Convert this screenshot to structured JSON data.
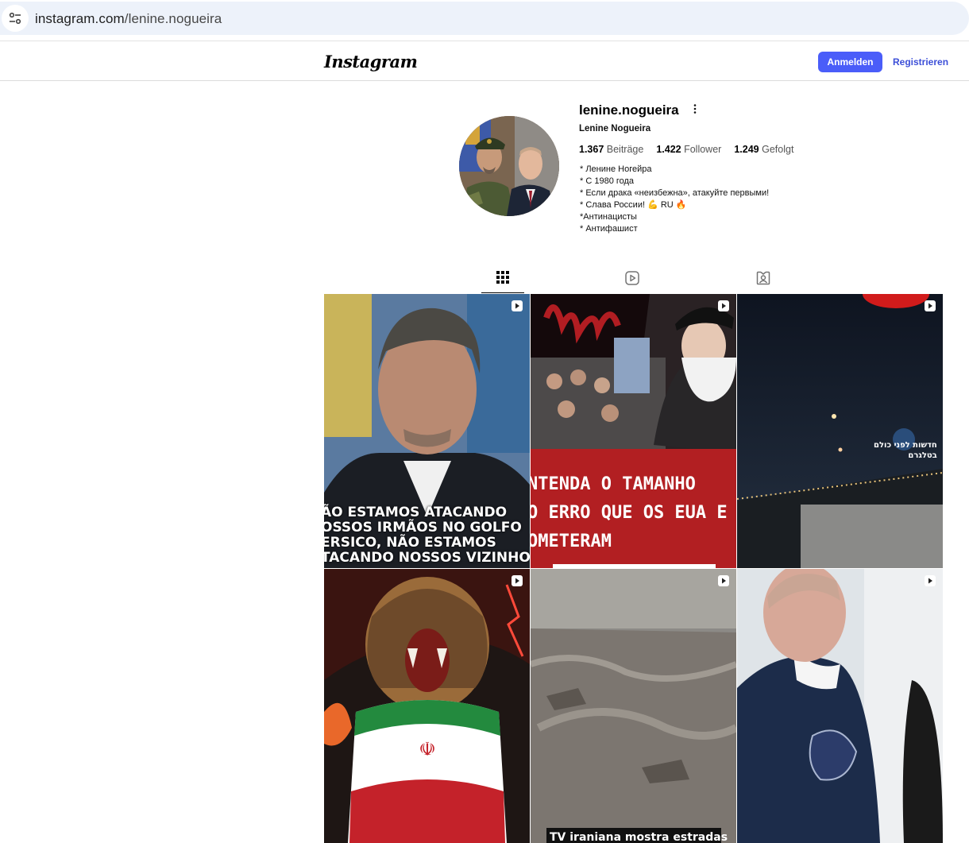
{
  "browser": {
    "url_domain": "instagram.com",
    "url_path": "/lenine.nogueira"
  },
  "header": {
    "logo": "Instagram",
    "login_label": "Anmelden",
    "register_label": "Registrieren"
  },
  "profile": {
    "username": "lenine.nogueira",
    "full_name": "Lenine Nogueira",
    "posts_count": "1.367",
    "posts_label": "Beiträge",
    "followers_count": "1.422",
    "followers_label": "Follower",
    "following_count": "1.249",
    "following_label": "Gefolgt",
    "bio": [
      "* Ленине Ногейра",
      "* С 1980 года",
      "* Если драка «неизбежна», атакуйте первыми!",
      "* Слава России! 💪 RU 🔥",
      "*Антинацисты",
      "* Антифашист"
    ]
  },
  "tabs": [
    "posts-grid",
    "reels",
    "tagged"
  ],
  "posts": {
    "p1_caption": [
      "ÃO ESTAMOS ATACANDO",
      "OSSOS IRMÃOS NO GOLFO",
      "ERSICO, NÃO ESTAMOS",
      "TACANDO NOSSOS VIZINHO"
    ],
    "p2_caption": [
      "NTENDA  O TAMANHO",
      "O ERRO QUE OS EUA E ISRA",
      "OMETERAM"
    ],
    "p3_watermark": [
      "חדשות לפני כולם",
      "בטלגרם"
    ],
    "p5_caption": "TV iraniana mostra estradas"
  },
  "colors": {
    "accent": "#4a5df9",
    "link": "#3c4fd8",
    "url_bar": "#edf2fa"
  }
}
